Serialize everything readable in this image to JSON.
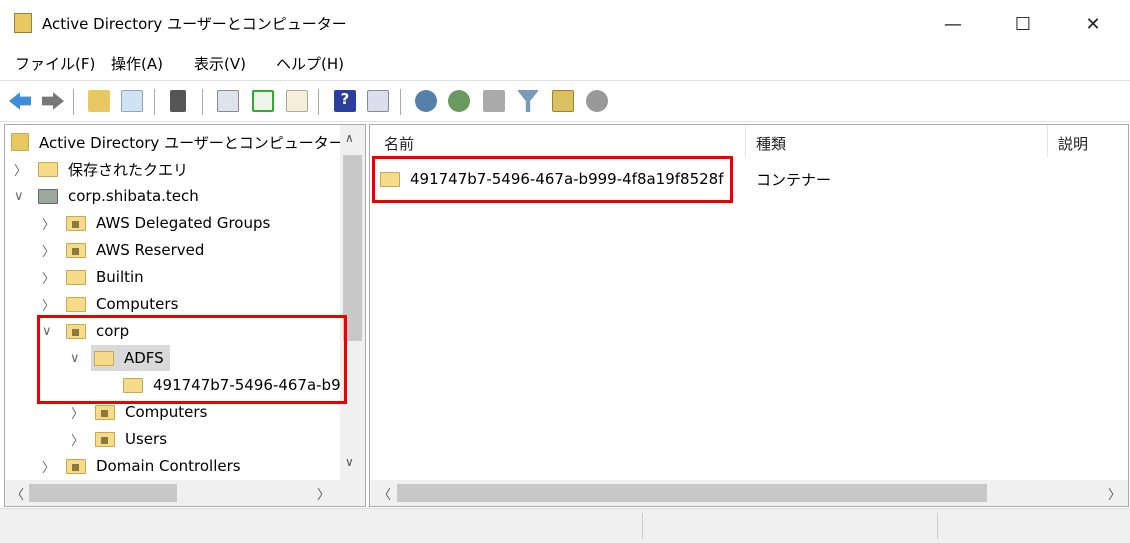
{
  "window": {
    "title": "Active Directory ユーザーとコンピューター",
    "minimize": "—",
    "maximize": "☐",
    "close": "✕"
  },
  "menu": [
    "ファイル(F)",
    "操作(A)",
    "表示(V)",
    "ヘルプ(H)"
  ],
  "toolbar": [
    "back",
    "forward",
    "up-folder",
    "show-hide-tree",
    "clipboard",
    "properties",
    "refresh",
    "export-list",
    "help",
    "show-hide-action",
    "new-user",
    "new-group",
    "new-ou",
    "filter",
    "find",
    "add-to-group"
  ],
  "tree": {
    "root": "Active Directory ユーザーとコンピューター [",
    "saved_queries": "保存されたクエリ",
    "domain": "corp.shibata.tech",
    "items": [
      "AWS Delegated Groups",
      "AWS Reserved",
      "Builtin",
      "Computers",
      "corp",
      "ADFS",
      "491747b7-5496-467a-b9",
      "Computers",
      "Users",
      "Domain Controllers"
    ]
  },
  "list": {
    "columns": [
      "名前",
      "種類",
      "説明"
    ],
    "rows": [
      {
        "name": "491747b7-5496-467a-b999-4f8a19f8528f",
        "type": "コンテナー",
        "desc": ""
      }
    ]
  },
  "colors": {
    "highlight": "#e00000",
    "selected": "#d9d9d9"
  }
}
